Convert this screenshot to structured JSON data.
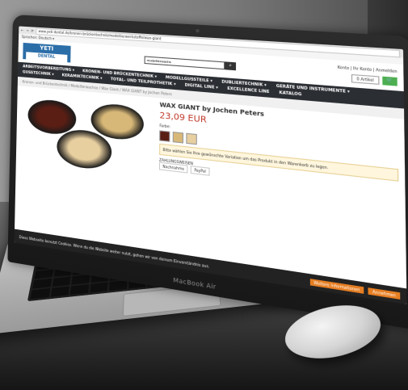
{
  "browser": {
    "url": "www.yeti-dental.de/kronen-brückentechnik/modellierwerkstoffe/wax-giant"
  },
  "site": {
    "language": "Sprachen: Deutsch ▾",
    "logo_main": "YETI",
    "logo_sub": "DENTAL",
    "search_value": "modellierwachs",
    "account_links": "Konto | Ihr Konto | Anmelden",
    "cart_label": "0 Artikel",
    "cart_button": "🛒"
  },
  "nav": {
    "items": [
      "ARBEITSVORBEREITUNG ▾",
      "KRONEN- UND BRÜCKENTECHNIK ▾",
      "MODELLGUSSTEILE ▾",
      "DUBLIERTECHNIK ▾",
      "GERÄTE UND INSTRUMENTE ▾",
      "GUSSTECHNIK ▾",
      "KERAMIKTECHNIK ▾",
      "TOTAL- UND TEILPROTHETIK ▾",
      "DIGITAL LINE ▾",
      "EXCELLENCE LINE",
      "KATALOG"
    ]
  },
  "breadcrumb": "Kronen- und Brückentechnik / Modellierwachse / Wax Giant / WAX GIANT by Jochen Peters",
  "product": {
    "title": "WAX GIANT by Jochen Peters",
    "price": "23,09 EUR",
    "color_label": "Farbe:",
    "note": "Bitte wählen Sie Ihre gewünschte Variation um das Produkt in den Warenkorb zu legen.",
    "payment_label": "ZAHLUNGSWEISEN",
    "payment_methods": [
      "Nachnahme",
      "PayPal"
    ],
    "swatch_colors": [
      "#5a1e14",
      "#d8b878",
      "#e8cfa0"
    ]
  },
  "cookie": {
    "text": "Diese Webseite benutzt Cookies. Wenn du die Website weiter nutzt, gehen wir von deinem Einverständnis aus.",
    "more_info": "Weitere Informationen",
    "accept": "Annehmen"
  },
  "laptop_brand": "MacBook Air"
}
